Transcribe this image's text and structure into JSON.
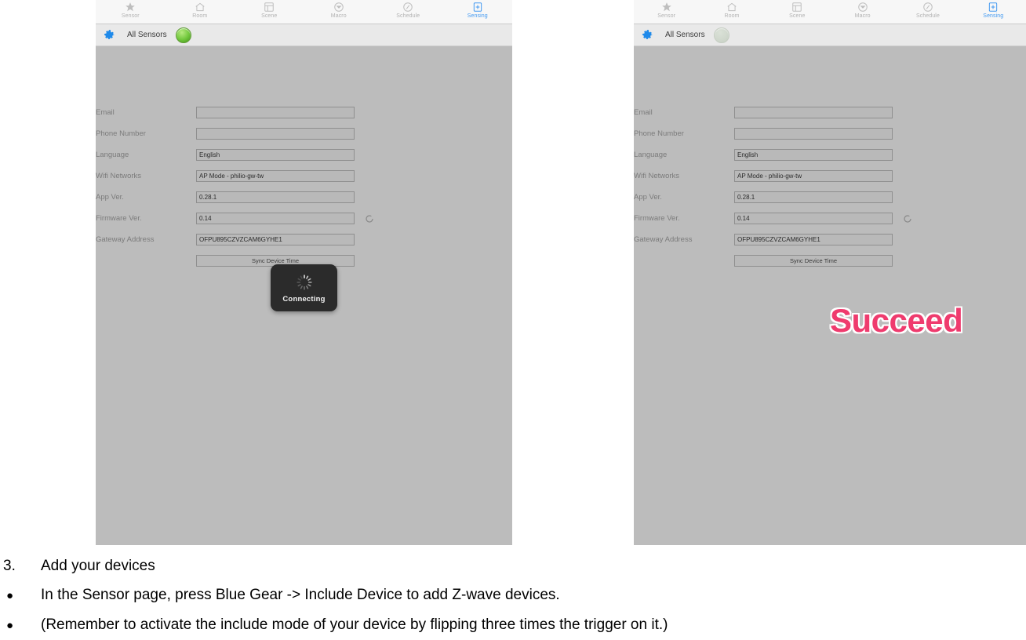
{
  "app": {
    "tabs": [
      {
        "label": "Sensor",
        "icon": "star-icon",
        "active": false
      },
      {
        "label": "Room",
        "icon": "home-icon",
        "active": false
      },
      {
        "label": "Scene",
        "icon": "scene-icon",
        "active": false
      },
      {
        "label": "Macro",
        "icon": "macro-icon",
        "active": false
      },
      {
        "label": "Schedule",
        "icon": "schedule-icon",
        "active": false
      },
      {
        "label": "Sensing",
        "icon": "sensing-icon",
        "active": true
      }
    ],
    "subbar": {
      "gear_icon": "gear-icon",
      "title": "All Sensors",
      "status_button": "green-status-button"
    },
    "form": {
      "rows": [
        {
          "label": "Email",
          "value": ""
        },
        {
          "label": "Phone Number",
          "value": ""
        },
        {
          "label": "Language",
          "value": "English"
        },
        {
          "label": "Wifi Networks",
          "value": "AP Mode - philio-gw-tw"
        },
        {
          "label": "App Ver.",
          "value": "0.28.1"
        },
        {
          "label": "Firmware Ver.",
          "value": "0.14"
        },
        {
          "label": "Gateway Address",
          "value": "OFPU895CZVZCAM6GYHE1"
        }
      ],
      "sync_button_label": "Sync Device Time",
      "refresh_icon": "refresh-icon"
    },
    "toast": {
      "label": "Connecting",
      "spinner_icon": "spinner-icon"
    },
    "succeed_banner": {
      "text": "Succeed",
      "color": "#ef3b6e"
    }
  },
  "colors": {
    "panel_background": "#bcbcbc",
    "tabbar_background": "#f7f7f7",
    "accent_blue": "#2b8df0",
    "gear_blue": "#1f8aea",
    "succeed_pink": "#ef3b6e",
    "toast_black": "#2b2b2b"
  },
  "caption": {
    "lines": [
      {
        "marker": "3.",
        "type": "number",
        "text": "Add your devices"
      },
      {
        "marker": "●",
        "type": "bullet",
        "text": "In the Sensor page, press Blue Gear -> Include Device to add Z-wave devices."
      },
      {
        "marker": "●",
        "type": "bullet",
        "text": "(Remember to activate the include mode of your device by flipping three times the trigger on it.)"
      }
    ]
  }
}
